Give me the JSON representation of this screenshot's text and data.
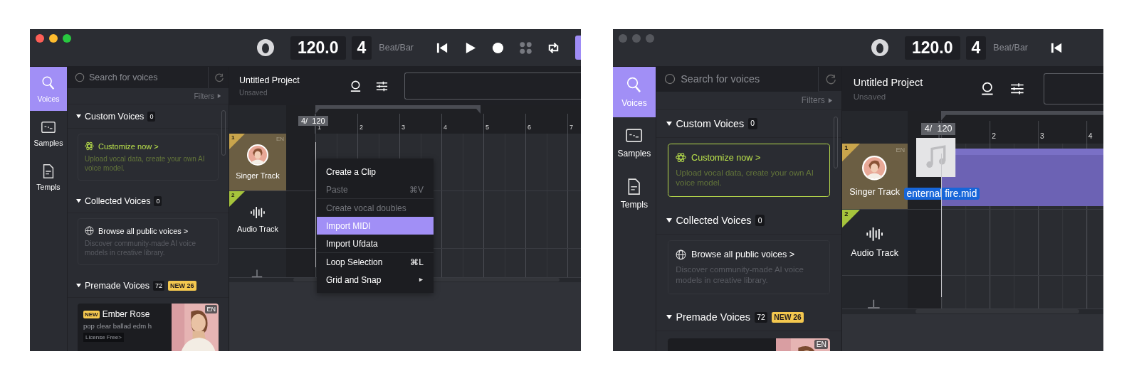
{
  "windows": [
    {
      "active": true,
      "toolbar": {
        "tempo": "120.0",
        "beats": "4",
        "beats_label": "Beat/Bar",
        "controls": [
          {
            "kind": "skip-back"
          },
          {
            "kind": "play"
          },
          {
            "kind": "record"
          },
          {
            "kind": "dots"
          },
          {
            "kind": "loop"
          },
          {
            "kind": "accent"
          }
        ]
      },
      "rail": [
        {
          "label": "Voices",
          "kind": "voices",
          "selected": true
        },
        {
          "label": "Samples",
          "kind": "samples",
          "selected": false
        },
        {
          "label": "Templs",
          "kind": "templates",
          "selected": false
        }
      ],
      "search": {
        "placeholder": "Search for voices"
      },
      "filters": "Filters",
      "sections": [
        {
          "title": "Custom Voices",
          "count": "0",
          "card": {
            "kind": "custom",
            "title": "Customize now >",
            "text": "Upload vocal data, create your own AI voice model.",
            "highlighted": false
          }
        },
        {
          "title": "Collected Voices",
          "count": "0",
          "card": {
            "kind": "collected",
            "title": "Browse all public voices >",
            "text": "Discover community-made AI voice models in creative library.",
            "highlighted": false
          }
        },
        {
          "title": "Premade Voices",
          "count": "72",
          "badge": "NEW 26",
          "voices": [
            {
              "badge": "NEW",
              "name": "Ember Rose",
              "tags": "pop clear ballad edm h",
              "license": "License Free>",
              "lang": "EN",
              "kind": "picture"
            }
          ]
        }
      ],
      "project": {
        "title": "Untitled Project",
        "status": "Unsaved"
      },
      "marker": "4/  120",
      "ruler": [
        "1",
        "2",
        "3",
        "4",
        "5",
        "6",
        "7"
      ],
      "tracks": [
        {
          "number": "1",
          "name": "Singer Track",
          "lang": "EN",
          "kind": "singer",
          "color": "#c9a54c"
        },
        {
          "number": "2",
          "name": "Audio Track",
          "kind": "audio",
          "color": "#a6c43c"
        }
      ],
      "context_menu": {
        "groups": [
          {
            "items": [
              {
                "label": "Create a Clip",
                "kind": "action",
                "disabled": false,
                "selected": false
              },
              {
                "label": "Paste",
                "shortcut": "⌘V",
                "kind": "action",
                "disabled": true,
                "selected": false
              }
            ]
          },
          {
            "items": [
              {
                "label": "Create vocal doubles",
                "kind": "action",
                "disabled": true,
                "selected": false
              },
              {
                "label": "Import MIDI",
                "kind": "action",
                "disabled": false,
                "selected": true
              },
              {
                "label": "Import Ufdata",
                "kind": "action",
                "disabled": false,
                "selected": false
              }
            ]
          },
          {
            "items": [
              {
                "label": "Loop Selection",
                "shortcut": "⌘L",
                "kind": "action",
                "disabled": false,
                "selected": false
              },
              {
                "label": "Grid and Snap",
                "kind": "submenu",
                "disabled": false,
                "selected": false
              }
            ]
          }
        ]
      }
    },
    {
      "active": false,
      "toolbar": {
        "tempo": "120.0",
        "beats": "4",
        "beats_label": "Beat/Bar",
        "controls": [
          {
            "kind": "skip-back"
          }
        ]
      },
      "rail": [
        {
          "label": "Voices",
          "kind": "voices",
          "selected": true
        },
        {
          "label": "Samples",
          "kind": "samples",
          "selected": false
        },
        {
          "label": "Templs",
          "kind": "templates",
          "selected": false
        }
      ],
      "search": {
        "placeholder": "Search for voices"
      },
      "filters": "Filters",
      "sections": [
        {
          "title": "Custom Voices",
          "count": "0",
          "card": {
            "kind": "custom",
            "title": "Customize now >",
            "text": "Upload vocal data, create your own AI voice model.",
            "highlighted": true
          }
        },
        {
          "title": "Collected Voices",
          "count": "0",
          "card": {
            "kind": "collected",
            "title": "Browse all public voices >",
            "text": "Discover community-made AI voice models in creative library.",
            "highlighted": false
          }
        },
        {
          "title": "Premade Voices",
          "count": "72",
          "badge": "NEW 26",
          "voices": [
            {
              "lang": "EN",
              "kind": "picture"
            }
          ]
        }
      ],
      "project": {
        "title": "Untitled Project",
        "status": "Unsaved"
      },
      "marker": "4/  120",
      "ruler": [
        "2",
        "3",
        "4"
      ],
      "tracks": [
        {
          "number": "1",
          "name": "Singer Track",
          "lang": "EN",
          "kind": "singer",
          "color": "#c9a54c"
        },
        {
          "number": "2",
          "name": "Audio Track",
          "kind": "audio",
          "color": "#a6c43c"
        }
      ],
      "drag": {
        "file": "enternal fire.mid"
      }
    }
  ]
}
